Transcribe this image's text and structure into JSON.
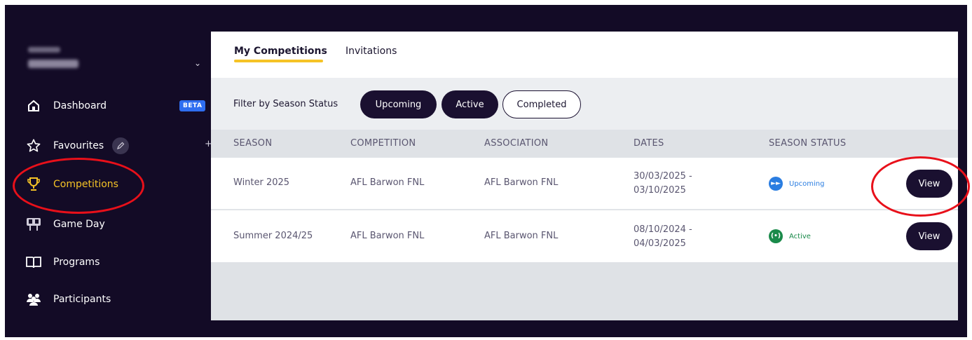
{
  "sidebar": {
    "org_selector": {
      "line1": "",
      "line2": ""
    },
    "items": [
      {
        "label": "Dashboard",
        "badge": "BETA",
        "icon": "home-icon"
      },
      {
        "label": "Favourites",
        "icon": "star-icon",
        "add": "+"
      },
      {
        "label": "Competitions",
        "icon": "trophy-icon",
        "active": true
      },
      {
        "label": "Game Day",
        "icon": "scoreboard-icon"
      },
      {
        "label": "Programs",
        "icon": "book-icon"
      },
      {
        "label": "Participants",
        "icon": "people-icon"
      }
    ]
  },
  "tabs": [
    {
      "label": "My Competitions",
      "active": true
    },
    {
      "label": "Invitations"
    }
  ],
  "filter": {
    "label": "Filter by Season Status",
    "chips": [
      {
        "label": "Upcoming",
        "selected": true
      },
      {
        "label": "Active",
        "selected": true
      },
      {
        "label": "Completed",
        "selected": false
      }
    ]
  },
  "table": {
    "headers": [
      "SEASON",
      "COMPETITION",
      "ASSOCIATION",
      "DATES",
      "SEASON STATUS"
    ],
    "rows": [
      {
        "season": "Winter 2025",
        "competition": "AFL Barwon FNL",
        "association": "AFL Barwon FNL",
        "date_start": "30/03/2025 -",
        "date_end": "03/10/2025",
        "status": "Upcoming",
        "action": "View"
      },
      {
        "season": "Summer 2024/25",
        "competition": "AFL Barwon FNL",
        "association": "AFL Barwon FNL",
        "date_start": "08/10/2024 -",
        "date_end": "04/03/2025",
        "status": "Active",
        "action": "View"
      }
    ]
  },
  "colors": {
    "sidebar_bg": "#130b26",
    "accent_yellow": "#f5c326",
    "beta_blue": "#2f6ef0",
    "status_upcoming": "#2a7de1",
    "status_active": "#1a8a4a",
    "dark_button": "#1a1030",
    "annotation_red": "#e8101a"
  }
}
